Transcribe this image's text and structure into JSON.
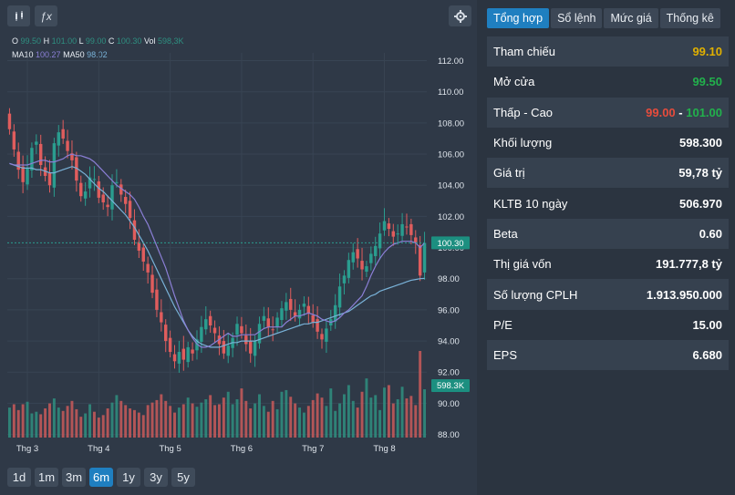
{
  "toolbar": {
    "candle_icon": "candlestick-icon",
    "fx_label": "ƒx",
    "settings_icon": "gear-icon"
  },
  "legend": {
    "o_label": "O",
    "o_value": "99.50",
    "h_label": "H",
    "h_value": "101.00",
    "l_label": "L",
    "l_value": "99.00",
    "c_label": "C",
    "c_value": "100.30",
    "vol_label": "Vol",
    "vol_value": "598,3K",
    "ma10_label": "MA10",
    "ma10_value": "100.27",
    "ma50_label": "MA50",
    "ma50_value": "98.02"
  },
  "ranges": [
    {
      "label": "1d",
      "active": false
    },
    {
      "label": "1m",
      "active": false
    },
    {
      "label": "3m",
      "active": false
    },
    {
      "label": "6m",
      "active": true
    },
    {
      "label": "1y",
      "active": false
    },
    {
      "label": "3y",
      "active": false
    },
    {
      "label": "5y",
      "active": false
    }
  ],
  "tabs": [
    {
      "label": "Tổng hợp",
      "active": true
    },
    {
      "label": "Sổ lệnh",
      "active": false
    },
    {
      "label": "Mức giá",
      "active": false
    },
    {
      "label": "Thống kê",
      "active": false
    }
  ],
  "stats": [
    {
      "label": "Tham chiếu",
      "value": "99.10",
      "color": "#e0b000"
    },
    {
      "label": "Mở cửa",
      "value": "99.50",
      "color": "#22b14c"
    },
    {
      "label": "Thấp - Cao",
      "low": "99.00",
      "sep": "-",
      "high": "101.00",
      "low_color": "#e74c3c",
      "high_color": "#22b14c"
    },
    {
      "label": "Khối lượng",
      "value": "598.300",
      "color": "#ffffff"
    },
    {
      "label": "Giá trị",
      "value": "59,78 tỷ",
      "color": "#ffffff"
    },
    {
      "label": "KLTB 10 ngày",
      "value": "506.970",
      "color": "#ffffff"
    },
    {
      "label": "Beta",
      "value": "0.60",
      "color": "#ffffff"
    },
    {
      "label": "Thị giá vốn",
      "value": "191.777,8 tỷ",
      "color": "#ffffff"
    },
    {
      "label": "Số lượng CPLH",
      "value": "1.913.950.000",
      "color": "#ffffff"
    },
    {
      "label": "P/E",
      "value": "15.00",
      "color": "#ffffff"
    },
    {
      "label": "EPS",
      "value": "6.680",
      "color": "#ffffff"
    }
  ],
  "chart_data": {
    "type": "candlestick",
    "y_ticks": [
      "112.00",
      "110.00",
      "108.00",
      "106.00",
      "104.00",
      "102.00",
      "100.00",
      "98.00",
      "96.00",
      "94.00",
      "92.00",
      "90.00",
      "88.00"
    ],
    "ylim": [
      87.8,
      112.5
    ],
    "x_ticks": [
      "Thg 3",
      "Thg 4",
      "Thg 5",
      "Thg 6",
      "Thg 7",
      "Thg 8"
    ],
    "last_price_label": "100.30",
    "last_price": 100.3,
    "last_volume_label": "598.3K",
    "colors": {
      "up": "#2a9d8f",
      "down": "#e05d5d",
      "ma10": "#8b7fd6",
      "ma50": "#79b2d8",
      "grid": "#384453"
    },
    "close": [
      107.6,
      106.3,
      105.0,
      104.2,
      105.1,
      106.4,
      106.8,
      105.3,
      104.6,
      104.0,
      106.7,
      107.4,
      107.0,
      106.2,
      105.6,
      104.3,
      103.3,
      103.6,
      104.5,
      104.4,
      103.2,
      102.9,
      102.6,
      104.0,
      104.2,
      103.4,
      102.8,
      101.9,
      100.5,
      99.8,
      99.1,
      98.4,
      97.1,
      96.0,
      95.2,
      94.0,
      93.3,
      92.7,
      93.3,
      92.8,
      93.6,
      93.2,
      94.1,
      94.9,
      95.4,
      95.0,
      94.5,
      93.8,
      93.2,
      93.7,
      94.2,
      95.1,
      94.5,
      93.8,
      93.2,
      94.0,
      95.1,
      95.6,
      94.9,
      94.7,
      95.5,
      96.1,
      96.5,
      96.0,
      95.6,
      96.0,
      96.4,
      95.8,
      95.2,
      94.6,
      94.1,
      94.8,
      95.4,
      96.3,
      97.5,
      98.2,
      99.2,
      99.7,
      99.3,
      98.6,
      98.8,
      99.6,
      100.1,
      100.9,
      101.7,
      101.2,
      100.7,
      100.9,
      101.5,
      101.3,
      100.8,
      100.3,
      98.2,
      100.3
    ],
    "volume": [
      36,
      40,
      33,
      40,
      43,
      29,
      31,
      28,
      35,
      41,
      47,
      36,
      32,
      38,
      44,
      34,
      25,
      29,
      40,
      31,
      24,
      27,
      35,
      42,
      51,
      44,
      39,
      35,
      33,
      30,
      27,
      39,
      42,
      45,
      52,
      44,
      38,
      30,
      36,
      40,
      48,
      41,
      37,
      42,
      46,
      51,
      39,
      40,
      48,
      55,
      40,
      46,
      59,
      44,
      35,
      41,
      52,
      38,
      31,
      44,
      34,
      55,
      57,
      49,
      41,
      36,
      30,
      38,
      45,
      53,
      48,
      38,
      59,
      32,
      41,
      52,
      63,
      44,
      36,
      55,
      71,
      48,
      51,
      33,
      60,
      63,
      41,
      46,
      61,
      47,
      50,
      39,
      104,
      58
    ],
    "ma10": [
      105.4,
      105.3,
      105.3,
      105.3,
      105.3,
      105.4,
      105.5,
      105.6,
      105.6,
      105.5,
      105.5,
      105.6,
      105.7,
      105.9,
      106.0,
      105.9,
      105.9,
      105.8,
      105.7,
      105.5,
      105.2,
      104.9,
      104.6,
      104.3,
      104.0,
      103.8,
      103.6,
      103.4,
      103.1,
      102.6,
      102.0,
      101.5,
      100.8,
      100.1,
      99.4,
      98.7,
      97.8,
      96.9,
      96.1,
      95.3,
      94.7,
      94.2,
      93.8,
      93.6,
      93.6,
      93.7,
      93.9,
      94.1,
      94.3,
      94.5,
      94.3,
      94.3,
      94.4,
      94.4,
      94.4,
      94.4,
      94.6,
      94.8,
      94.9,
      94.9,
      94.9,
      94.9,
      95.2,
      95.4,
      95.6,
      95.6,
      95.7,
      95.8,
      95.7,
      95.6,
      95.4,
      95.3,
      95.2,
      95.3,
      95.5,
      95.8,
      96.0,
      96.3,
      96.6,
      96.9,
      97.5,
      98.2,
      98.8,
      99.3,
      99.7,
      100.0,
      100.2,
      100.3,
      100.4,
      100.4,
      100.4,
      100.3,
      100.0,
      100.3
    ],
    "ma50": [
      105.4,
      105.3,
      105.2,
      105.1,
      105.1,
      105.1,
      105.0,
      105.0,
      104.9,
      104.8,
      104.8,
      104.9,
      105.0,
      105.1,
      105.2,
      105.1,
      104.9,
      104.7,
      104.4,
      104.1,
      103.8,
      103.6,
      103.3,
      103.0,
      102.7,
      102.4,
      102.1,
      101.7,
      101.3,
      100.8,
      100.3,
      99.8,
      99.2,
      98.6,
      98.0,
      97.4,
      96.8,
      96.2,
      95.7,
      95.2,
      94.7,
      94.3,
      94.0,
      93.8,
      93.7,
      93.6,
      93.6,
      93.6,
      93.7,
      93.8,
      93.9,
      93.9,
      94.0,
      94.0,
      94.0,
      94.0,
      94.1,
      94.2,
      94.3,
      94.4,
      94.5,
      94.6,
      94.7,
      94.8,
      94.9,
      95.0,
      95.1,
      95.1,
      95.2,
      95.2,
      95.3,
      95.4,
      95.5,
      95.6,
      95.7,
      95.8,
      95.9,
      96.1,
      96.3,
      96.5,
      96.7,
      96.9,
      97.0,
      97.2,
      97.3,
      97.4,
      97.5,
      97.6,
      97.7,
      97.8,
      97.9,
      97.95,
      98.0,
      98.02
    ]
  }
}
